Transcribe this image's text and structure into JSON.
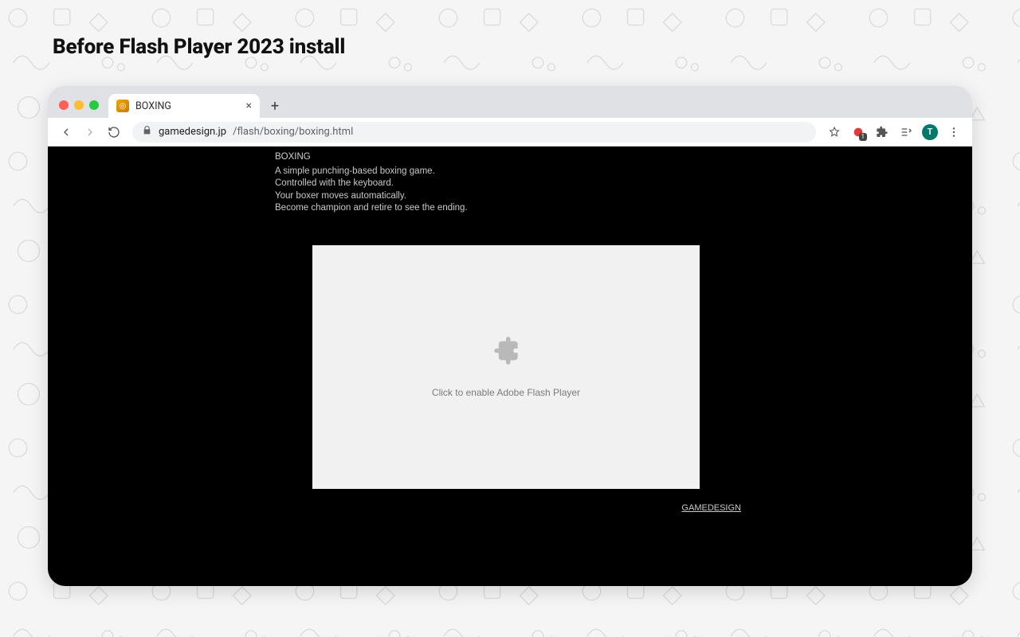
{
  "heading": "Before Flash Player 2023 install",
  "tab": {
    "title": "BOXING"
  },
  "toolbar": {
    "url_host": "gamedesign.jp",
    "url_path": "/flash/boxing/boxing.html",
    "avatar_letter": "T",
    "ext_badge": "1"
  },
  "page": {
    "title": "BOXING",
    "line1": "A simple punching-based boxing game.",
    "line2": "Controlled with the keyboard.",
    "line3": "Your boxer moves automatically.",
    "line4": "Become champion and retire to see the ending.",
    "flash_msg": "Click to enable Adobe Flash Player",
    "footer_link": "GAMEDESIGN"
  }
}
